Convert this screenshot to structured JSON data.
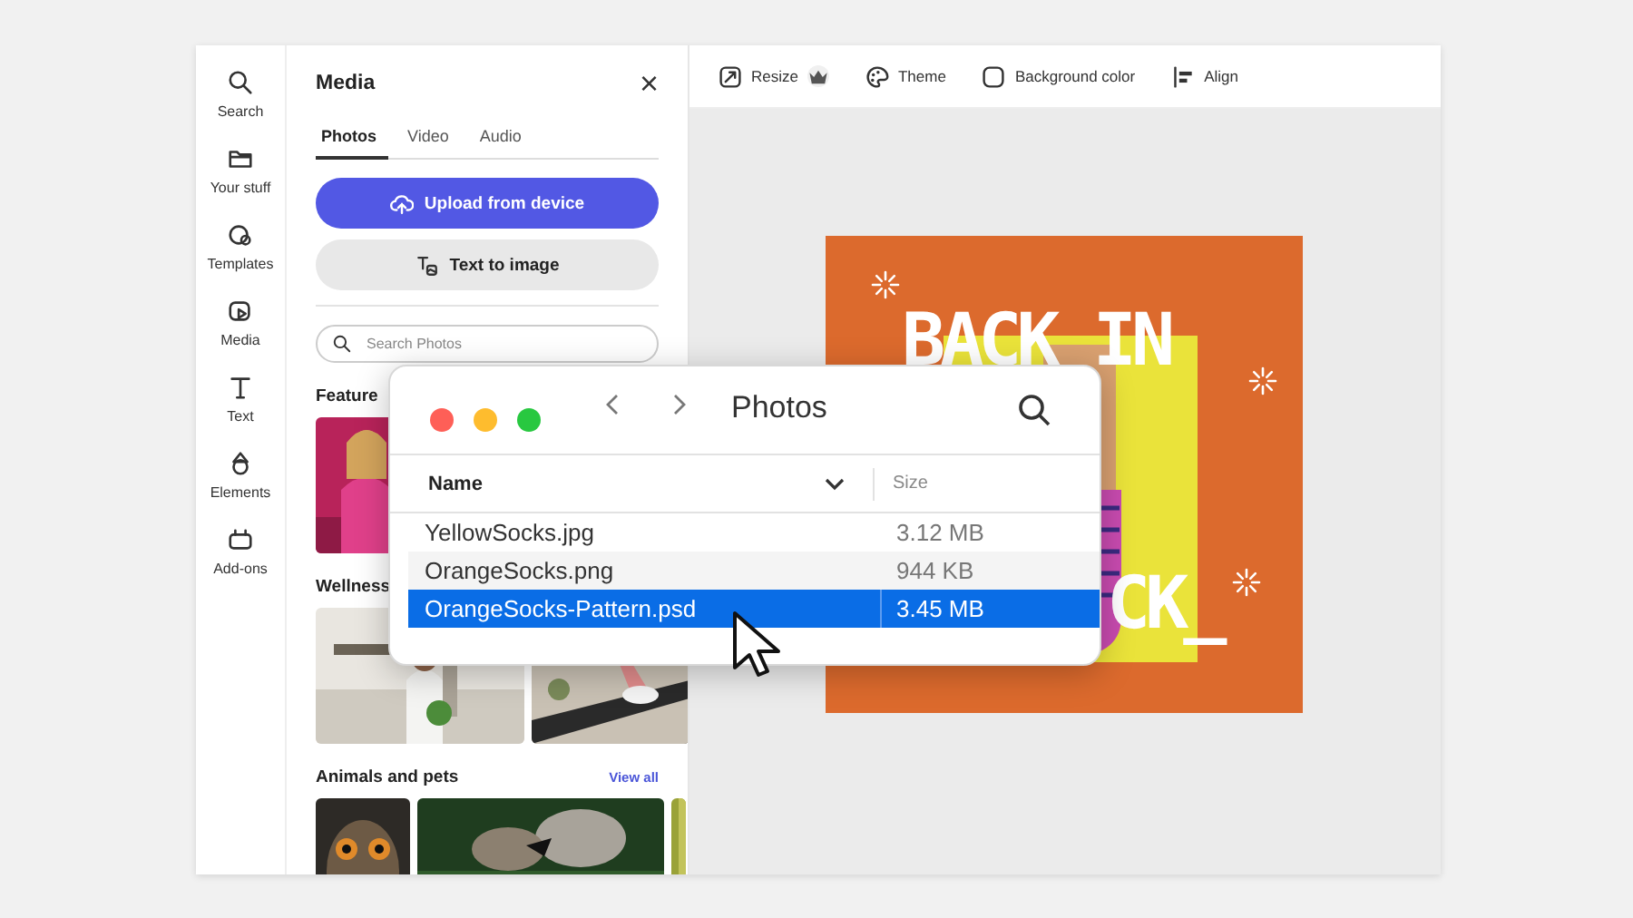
{
  "rail": [
    {
      "label": "Search"
    },
    {
      "label": "Your stuff"
    },
    {
      "label": "Templates"
    },
    {
      "label": "Media"
    },
    {
      "label": "Text"
    },
    {
      "label": "Elements"
    },
    {
      "label": "Add-ons"
    }
  ],
  "panel": {
    "title": "Media",
    "close": "×",
    "tabs": [
      {
        "label": "Photos",
        "selected": true
      },
      {
        "label": "Video",
        "selected": false
      },
      {
        "label": "Audio",
        "selected": false
      }
    ],
    "buttons": [
      {
        "label": "Upload from device",
        "kind": "primary"
      },
      {
        "label": "Text to image",
        "kind": "secondary"
      }
    ],
    "search": {
      "placeholder": "Search Photos"
    },
    "sections": [
      {
        "title": "Feature"
      },
      {
        "title": "Wellness"
      },
      {
        "title": "Animals and pets",
        "link": "View all"
      }
    ]
  },
  "toolbar": [
    {
      "label": "Resize",
      "premium": true
    },
    {
      "label": "Theme",
      "premium": false
    },
    {
      "label": "Background color",
      "premium": false
    },
    {
      "label": "Align",
      "premium": false
    }
  ],
  "design": {
    "lines": [
      "BACK IN",
      "CK_"
    ]
  },
  "dialog": {
    "title": "Photos",
    "columns": [
      "Name",
      "Size"
    ],
    "rows": [
      {
        "name": "YellowSocks.jpg",
        "size": "3.12 MB",
        "selected": false
      },
      {
        "name": "OrangeSocks.png",
        "size": "944 KB",
        "selected": false
      },
      {
        "name": "OrangeSocks-Pattern.psd",
        "size": "3.45 MB",
        "selected": true
      }
    ]
  }
}
